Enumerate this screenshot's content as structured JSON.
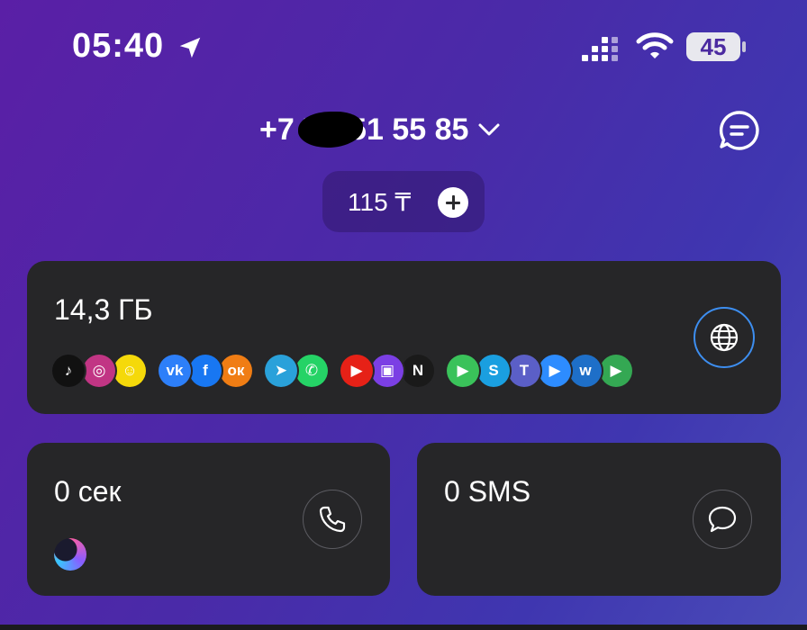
{
  "status_bar": {
    "time": "05:40",
    "battery": "45",
    "icons": [
      "location-arrow-icon",
      "signal-icon",
      "wifi-icon",
      "battery-icon"
    ]
  },
  "header": {
    "phone_prefix": "+7 7",
    "phone_suffix": "651 55 85",
    "balance": "115 ₸",
    "icons": [
      "chevron-down-icon",
      "chat-icon",
      "plus-icon"
    ]
  },
  "data_card": {
    "value": "14,3 ГБ",
    "apps": [
      {
        "name": "tiktok",
        "glyph": "♪",
        "color": "#111111"
      },
      {
        "name": "instagram",
        "glyph": "◎",
        "color": "#c13584"
      },
      {
        "name": "snapchat",
        "glyph": "☺",
        "color": "#f5d90a"
      },
      {
        "name": "vk",
        "glyph": "vk",
        "color": "#2d7ff9"
      },
      {
        "name": "facebook",
        "glyph": "f",
        "color": "#1877f2"
      },
      {
        "name": "odnoklassniki",
        "glyph": "ок",
        "color": "#f07d14"
      },
      {
        "name": "telegram",
        "glyph": "➤",
        "color": "#2aa1da"
      },
      {
        "name": "whatsapp",
        "glyph": "✆",
        "color": "#25d366"
      },
      {
        "name": "youtube",
        "glyph": "▶",
        "color": "#e62117"
      },
      {
        "name": "twitch",
        "glyph": "▣",
        "color": "#7b3fe4"
      },
      {
        "name": "netflix",
        "glyph": "N",
        "color": "#1a1a1a"
      },
      {
        "name": "facetime",
        "glyph": "▶",
        "color": "#3ac25a"
      },
      {
        "name": "skype",
        "glyph": "S",
        "color": "#1a9fe0"
      },
      {
        "name": "teams",
        "glyph": "T",
        "color": "#5b5fc7"
      },
      {
        "name": "zoom",
        "glyph": "▶",
        "color": "#2d8cff"
      },
      {
        "name": "webex",
        "glyph": "w",
        "color": "#1e6fc8"
      },
      {
        "name": "google-meet",
        "glyph": "▶",
        "color": "#34a853"
      }
    ]
  },
  "minutes_card": {
    "value": "0 сек"
  },
  "sms_card": {
    "value": "0 SMS"
  },
  "colors": {
    "accent_ring": "#3d8ef0",
    "card_bg": "#262628"
  }
}
